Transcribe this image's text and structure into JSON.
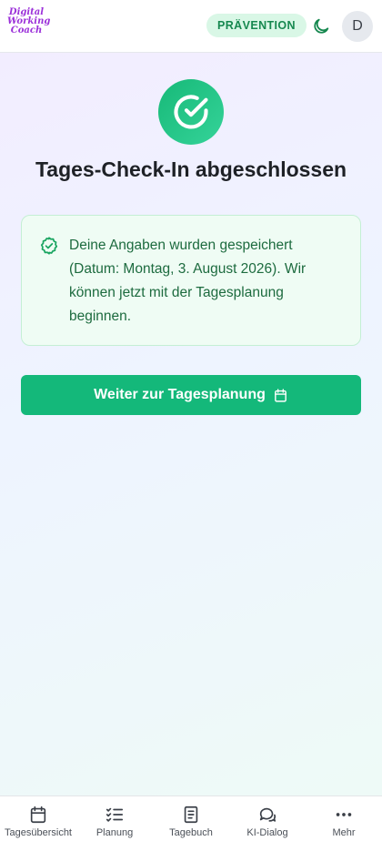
{
  "header": {
    "logo_lines": [
      "Digital",
      "Working",
      "Coach"
    ],
    "badge": "PRÄVENTION",
    "theme_toggle_icon": "moon-icon",
    "avatar_initial": "D"
  },
  "main": {
    "status_icon": "check-circle-icon",
    "title": "Tages-Check-In abgeschlossen",
    "notice_icon": "badge-check-icon",
    "notice_text": "Deine Angaben wurden gespeichert (Datum: Montag, 3. August 2026). Wir können jetzt mit der Tagesplanung beginnen.",
    "cta_label": "Weiter zur Tagesplanung",
    "cta_icon": "calendar-icon"
  },
  "nav": {
    "items": [
      {
        "label": "Tagesübersicht",
        "icon": "calendar-icon"
      },
      {
        "label": "Planung",
        "icon": "list-checks-icon"
      },
      {
        "label": "Tagebuch",
        "icon": "notebook-icon"
      },
      {
        "label": "KI-Dialog",
        "icon": "chat-bubbles-icon"
      },
      {
        "label": "Mehr",
        "icon": "more-dots-icon"
      }
    ]
  },
  "colors": {
    "accent": "#14b87a",
    "badge_bg": "#d9f7e6",
    "notice_bg": "#effcf4",
    "notice_text": "#1d6b3f",
    "logo": "#9b30d9"
  }
}
